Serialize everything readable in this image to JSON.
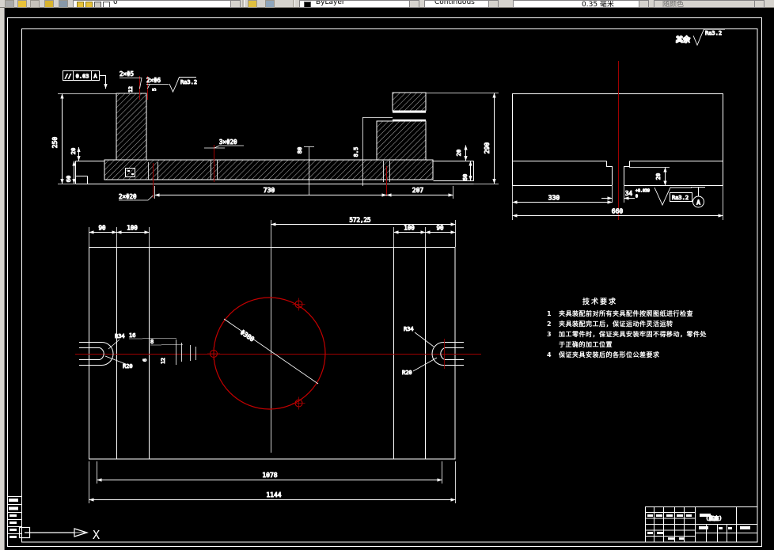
{
  "toolbar": {
    "layer_value": "0",
    "color_value": "ByLayer",
    "linetype_value": "Continuous",
    "lineweight_value": "0.35 毫米",
    "plotstyle_value": "随颜色",
    "icons": [
      "layer-bulb-icon",
      "layer-sun-icon",
      "layer-lock-icon",
      "color-swatch-icon",
      "layers-icon",
      "make-layer-current-icon"
    ]
  },
  "front_section": {
    "gdt_symbol": "//",
    "gdt_value": "0.03",
    "gdt_datum": "A",
    "dim_2xd5": "2×Φ5",
    "dim_2xd6": "2×Φ6",
    "dim_12": "12",
    "dim_5": "5",
    "surface_ra": "Ra3.2",
    "dim_250": "250",
    "dim_20_left": "20",
    "dim_60_left": "60",
    "dim_3xd20": "3×Φ20",
    "dim_80": "80",
    "dim_8_5": "8.5",
    "dim_20_right": "20",
    "dim_60_right": "60",
    "dim_290": "290",
    "dim_2xd20": "2×Φ20",
    "dim_730": "730",
    "dim_207": "207"
  },
  "side_section": {
    "others_label": "其余",
    "others_ra": "Ra3.2",
    "dim_20": "20",
    "dim_34": "34",
    "dim_34_tol_upper": "+0.039",
    "dim_34_tol_lower": "0",
    "dim_330": "330",
    "dim_660": "660",
    "surface_ra": "Ra3.2",
    "datum_label": "A"
  },
  "plan_view": {
    "dim_90_left": "90",
    "dim_100_left": "100",
    "dim_572": "572,25",
    "dim_100_right": "100",
    "dim_90_right": "90",
    "dim_circle": "Φ380",
    "dim_r34_left": "R34",
    "dim_r20_left": "R20",
    "dim_16": "16",
    "dim_8": "8",
    "dim_6": "6",
    "dim_12": "12",
    "dim_r34_right": "R34",
    "dim_r20_right": "R20",
    "dim_1078": "1078",
    "dim_1144": "1144"
  },
  "tech_requirements": {
    "title": "技术要求",
    "items": [
      {
        "num": "1",
        "text": "夹具装配前对所有夹具配件按照图纸进行检查"
      },
      {
        "num": "2",
        "text": "夹具装配完工后，保证运动件灵活运转"
      },
      {
        "num": "3",
        "text": "加工零件时，保证夹具安装牢固不得移动，零件处于正确的加工位置"
      },
      {
        "num": "4",
        "text": "保证夹具安装后的各形位公差要求"
      }
    ]
  },
  "title_block": {
    "part_name": "(底座)"
  },
  "ucs": {
    "x_label": "X"
  },
  "colors": {
    "centerline_red": "#9e0000",
    "circle_red": "#c40000",
    "line_white": "#ffffff",
    "toolbar_gray": "#d6d3ce"
  }
}
